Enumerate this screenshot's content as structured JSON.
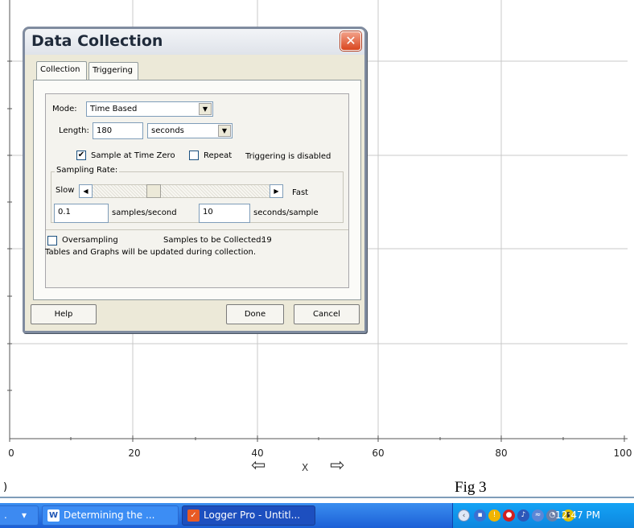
{
  "graph": {
    "x_ticks": [
      "0",
      "20",
      "40",
      "60",
      "80",
      "100"
    ],
    "x_axis_label": "X",
    "arrow_left": "⇦",
    "arrow_right": "⇨"
  },
  "figure_caption": "Fig 3",
  "stub_text": ")",
  "dialog": {
    "title": "Data Collection",
    "close_glyph": "✕",
    "tabs": [
      "Collection",
      "Triggering"
    ],
    "mode_label": "Mode:",
    "mode_value": "Time Based",
    "length_label": "Length:",
    "length_value": "180",
    "length_unit": "seconds",
    "sample_at_time_zero_label": "Sample at Time Zero",
    "sample_at_time_zero_checked": true,
    "repeat_label": "Repeat",
    "repeat_checked": false,
    "triggering_status": "Triggering is disabled",
    "sampling_rate_label": "Sampling Rate:",
    "slow_label": "Slow",
    "fast_label": "Fast",
    "samples_per_second_value": "0.1",
    "samples_per_second_label": "samples/second",
    "seconds_per_sample_value": "10",
    "seconds_per_sample_label": "seconds/sample",
    "oversampling_label": "Oversampling",
    "oversampling_checked": false,
    "samples_to_collect_label": "Samples to be Collected:",
    "samples_to_collect_value": "19",
    "update_note": "Tables and Graphs will be updated during collection.",
    "buttons": {
      "help": "Help",
      "done": "Done",
      "cancel": "Cancel"
    },
    "dropdown_glyph": "▼",
    "scroll_left_glyph": "◀",
    "scroll_right_glyph": "▶",
    "check_glyph": "✔"
  },
  "taskbar": {
    "dropdown_item": ".",
    "dropdown_glyph": "▾",
    "word_task": "Determining the ...",
    "logger_task": "Logger Pro - Untitl...",
    "clock": "12:47 PM",
    "colors": {
      "taskbar": "#1c5fd6",
      "tray": "#0d86df"
    }
  }
}
